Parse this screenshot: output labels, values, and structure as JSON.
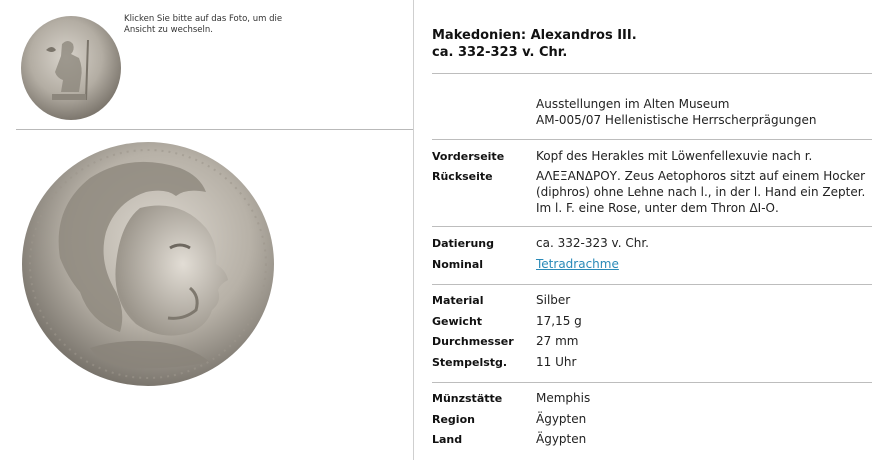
{
  "photo_hint": "Klicken Sie bitte auf das Foto, um die Ansicht zu wechseln.",
  "title": {
    "line1": "Makedonien: Alexandros III.",
    "line2": "ca. 332-323 v. Chr."
  },
  "exhibition": {
    "line1": "Ausstellungen im Alten Museum",
    "line2": "AM-005/07 Hellenistische Herrscherprägungen"
  },
  "details": {
    "obverse_label": "Vorderseite",
    "obverse": "Kopf des Herakles mit Löwenfellexuvie nach r.",
    "reverse_label": "Rückseite",
    "reverse_line1": "ΑΛΕΞΑΝΔΡΟΥ. Zeus Aetophoros sitzt auf einem Hocker",
    "reverse_line2": "(diphros) ohne Lehne nach l., in der l. Hand ein Zepter.",
    "reverse_line3": "Im l. F. eine Rose, unter dem Thron ΔΙ-Ο.",
    "date_label": "Datierung",
    "date": "ca. 332-323 v. Chr.",
    "nominal_label": "Nominal",
    "nominal": "Tetradrachme",
    "material_label": "Material",
    "material": "Silber",
    "weight_label": "Gewicht",
    "weight": "17,15 g",
    "diameter_label": "Durchmesser",
    "diameter": "27 mm",
    "die_label": "Stempelstg.",
    "die": "11 Uhr",
    "mint_label": "Münzstätte",
    "mint": "Memphis",
    "region_label": "Region",
    "region": "Ägypten",
    "country_label": "Land",
    "country": "Ägypten"
  },
  "colors": {
    "link": "#2a8ab8",
    "rule": "#bdbdbd",
    "coin_silver": "#b9b3a9"
  }
}
